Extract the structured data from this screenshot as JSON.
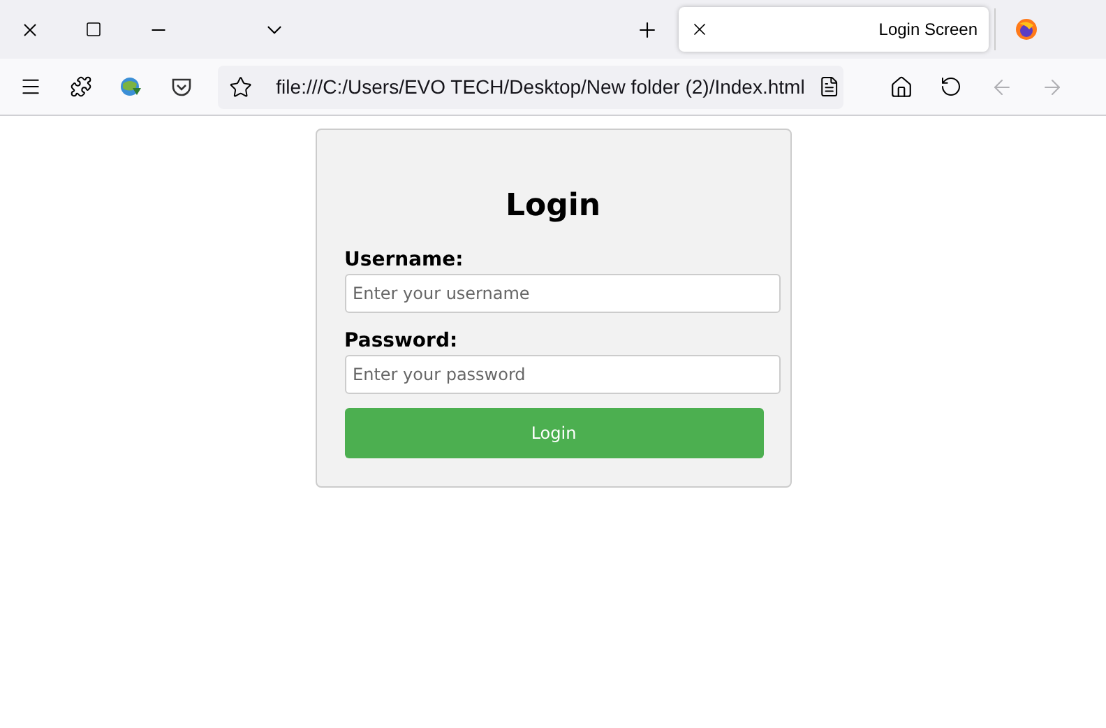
{
  "window": {
    "tab": {
      "title": "Login Screen",
      "selected": true
    }
  },
  "toolbar": {
    "address": "file:///C:/Users/EVO TECH/Desktop/New folder (2)/Index.html"
  },
  "login_form": {
    "heading": "Login",
    "fields": [
      {
        "label": "Username:",
        "placeholder": "Enter your username"
      },
      {
        "label": "Password:",
        "placeholder": "Enter your password"
      }
    ],
    "button": "Login"
  }
}
